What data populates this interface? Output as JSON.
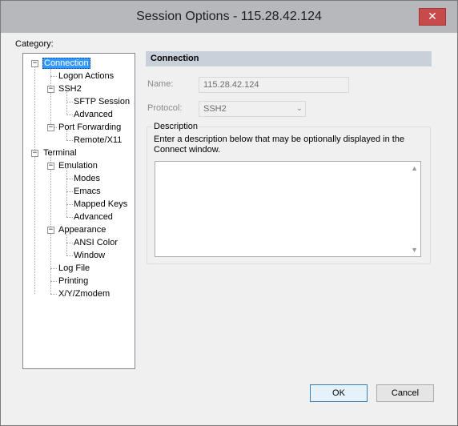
{
  "window": {
    "title": "Session Options - 115.28.42.124",
    "close_glyph": "✕"
  },
  "category": {
    "label": "Category:",
    "tree": [
      {
        "label": "Connection",
        "selected": true
      },
      {
        "label": "Logon Actions"
      },
      {
        "label": "SSH2"
      },
      {
        "label": "SFTP Session"
      },
      {
        "label": "Advanced"
      },
      {
        "label": "Port Forwarding"
      },
      {
        "label": "Remote/X11"
      },
      {
        "label": "Terminal"
      },
      {
        "label": "Emulation"
      },
      {
        "label": "Modes"
      },
      {
        "label": "Emacs"
      },
      {
        "label": "Mapped Keys"
      },
      {
        "label": "Advanced"
      },
      {
        "label": "Appearance"
      },
      {
        "label": "ANSI Color"
      },
      {
        "label": "Window"
      },
      {
        "label": "Log File"
      },
      {
        "label": "Printing"
      },
      {
        "label": "X/Y/Zmodem"
      }
    ]
  },
  "panel": {
    "header": "Connection",
    "name_label": "Name:",
    "name_value": "115.28.42.124",
    "protocol_label": "Protocol:",
    "protocol_value": "SSH2",
    "description_title": "Description",
    "description_text": "Enter a description below that may be optionally displayed in the Connect window.",
    "description_value": ""
  },
  "buttons": {
    "ok": "OK",
    "cancel": "Cancel"
  },
  "icons": {
    "expand_minus": "−",
    "combo_arrow": "⌄",
    "scroll_up": "▲",
    "scroll_down": "▼"
  },
  "colors": {
    "selection": "#3399ff",
    "header_bar": "#c8d0da",
    "close_button": "#c74b4b"
  }
}
